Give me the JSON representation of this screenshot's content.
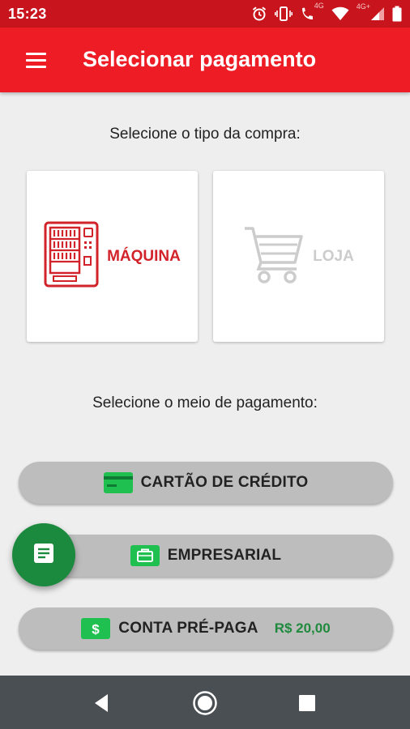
{
  "status_bar": {
    "time": "15:23",
    "icons": [
      "alarm-icon",
      "vibrate-icon",
      "wifi-call-icon",
      "wifi-icon",
      "cellular-signal-icon",
      "battery-icon"
    ],
    "network_label": "4G+",
    "call_label": "4G"
  },
  "app_bar": {
    "title": "Selecionar pagamento",
    "menu_icon": "hamburger-menu-icon"
  },
  "purchase_type": {
    "prompt": "Selecione o tipo da compra:",
    "options": [
      {
        "label": "MÁQUINA",
        "icon": "vending-machine-icon",
        "selected": true
      },
      {
        "label": "LOJA",
        "icon": "shopping-cart-icon",
        "selected": false
      }
    ]
  },
  "payment_method": {
    "prompt": "Selecione o meio de pagamento:",
    "options": [
      {
        "label": "CARTÃO DE CRÉDITO",
        "icon": "credit-card-icon"
      },
      {
        "label": "EMPRESARIAL",
        "icon": "briefcase-icon"
      },
      {
        "label": "CONTA PRÉ-PAGA",
        "icon": "dollar-icon",
        "amount": "R$ 20,00"
      }
    ]
  },
  "fab": {
    "icon": "receipt-list-icon"
  },
  "nav_bar": {
    "buttons": [
      "back-icon",
      "home-icon",
      "recents-icon"
    ]
  },
  "colors": {
    "status_bar": "#c8141c",
    "app_bar": "#ee1c25",
    "accent_red": "#d2232a",
    "green": "#1b8a3e",
    "amount_green": "#1f8a3e",
    "button_gray": "#bdbdbd",
    "background": "#eeeeee",
    "nav_bar": "#4a4f54"
  }
}
